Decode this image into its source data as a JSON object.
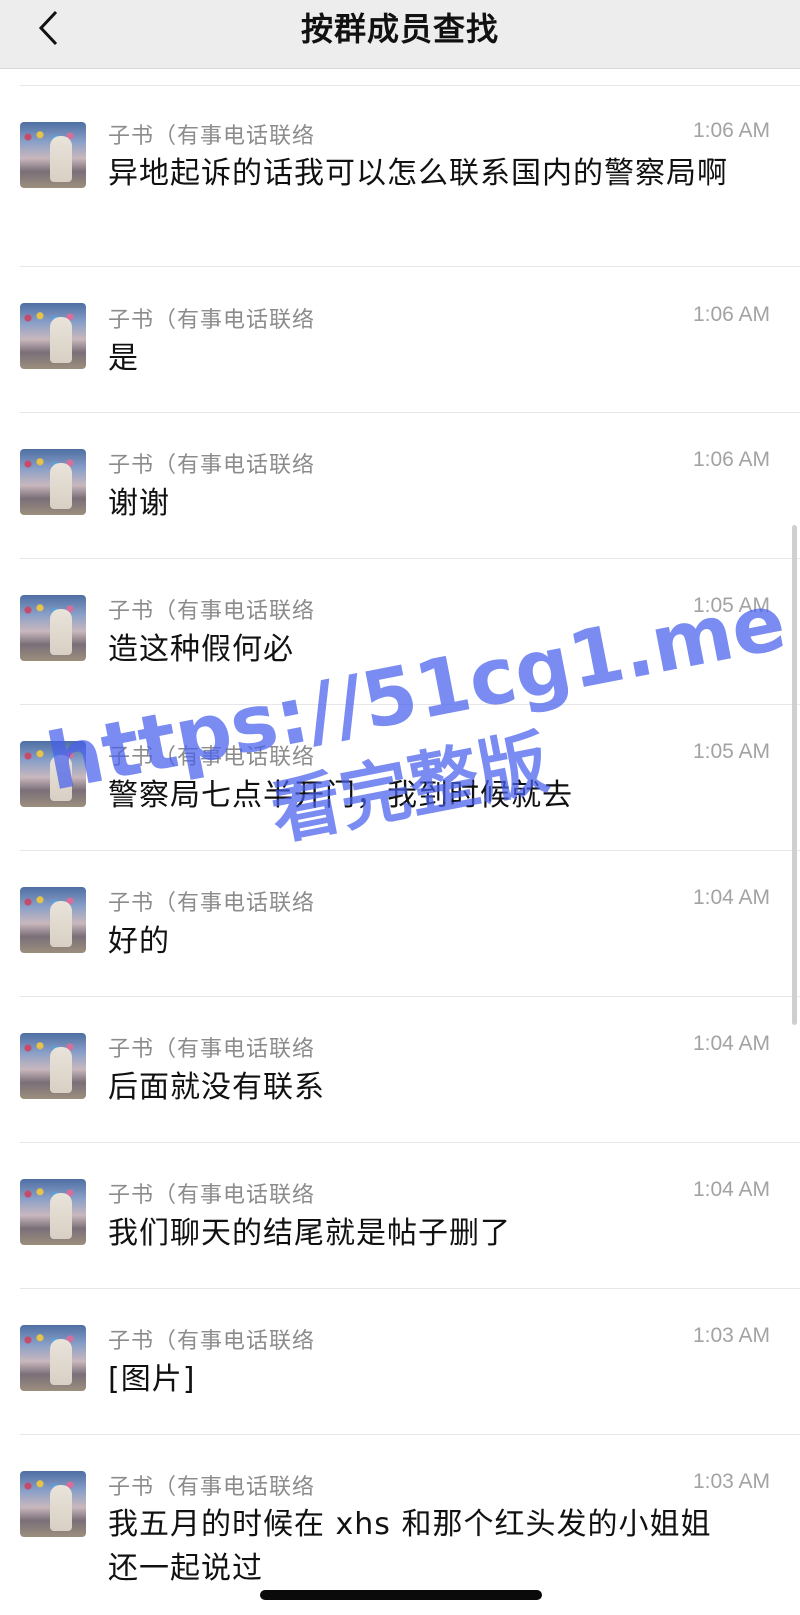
{
  "header": {
    "title": "按群成员查找"
  },
  "messages": [
    {
      "sender": "子书（有事电话联络",
      "time": "1:06 AM",
      "text": "异地起诉的话我可以怎么联系国内的警察局啊"
    },
    {
      "sender": "子书（有事电话联络",
      "time": "1:06 AM",
      "text": "是"
    },
    {
      "sender": "子书（有事电话联络",
      "time": "1:06 AM",
      "text": "谢谢"
    },
    {
      "sender": "子书（有事电话联络",
      "time": "1:05 AM",
      "text": "造这种假何必"
    },
    {
      "sender": "子书（有事电话联络",
      "time": "1:05 AM",
      "text": "警察局七点半开门，我到时候就去"
    },
    {
      "sender": "子书（有事电话联络",
      "time": "1:04 AM",
      "text": "好的"
    },
    {
      "sender": "子书（有事电话联络",
      "time": "1:04 AM",
      "text": "后面就没有联系"
    },
    {
      "sender": "子书（有事电话联络",
      "time": "1:04 AM",
      "text": "我们聊天的结尾就是帖子删了"
    },
    {
      "sender": "子书（有事电话联络",
      "time": "1:03 AM",
      "text": "[图片]"
    },
    {
      "sender": "子书（有事电话联络",
      "time": "1:03 AM",
      "text": "我五月的时候在 xhs 和那个红头发的小姐姐还一起说过"
    }
  ],
  "watermark": {
    "url": "https://51cg1.me",
    "subtitle": "看完整版"
  },
  "colors": {
    "nav_bg": "#ededed",
    "watermark": "#465feb"
  }
}
